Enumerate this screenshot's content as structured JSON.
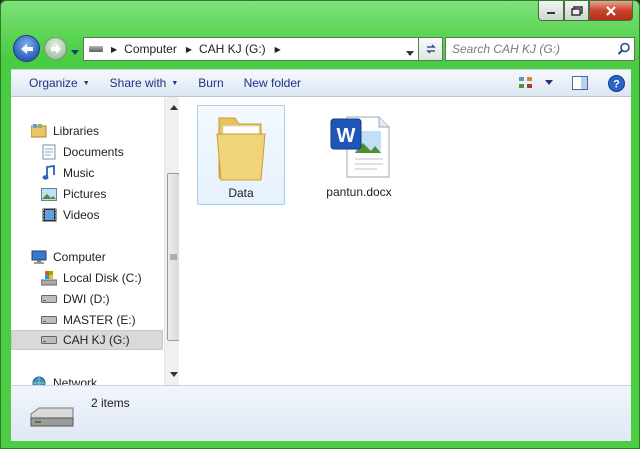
{
  "window": {
    "caption_buttons": [
      "minimize",
      "maximize",
      "close"
    ]
  },
  "address_bar": {
    "icon": "drive-icon",
    "breadcrumbs": [
      "Computer",
      "CAH KJ (G:)"
    ]
  },
  "search": {
    "placeholder": "Search CAH KJ (G:)"
  },
  "toolbar": {
    "items": [
      {
        "label": "Organize",
        "dropdown": true
      },
      {
        "label": "Share with",
        "dropdown": true
      },
      {
        "label": "Burn",
        "dropdown": false
      },
      {
        "label": "New folder",
        "dropdown": false
      }
    ],
    "right_icons": [
      "view-options-icon",
      "preview-pane-icon",
      "help-icon"
    ]
  },
  "nav_pane": {
    "items": [
      {
        "label": "Libraries",
        "icon": "libraries-icon",
        "level": 0
      },
      {
        "label": "Documents",
        "icon": "documents-icon",
        "level": 1
      },
      {
        "label": "Music",
        "icon": "music-icon",
        "level": 1
      },
      {
        "label": "Pictures",
        "icon": "pictures-icon",
        "level": 1
      },
      {
        "label": "Videos",
        "icon": "videos-icon",
        "level": 1
      },
      {
        "label": "Computer",
        "icon": "computer-icon",
        "level": 0
      },
      {
        "label": "Local Disk (C:)",
        "icon": "local-disk-icon",
        "level": 1
      },
      {
        "label": "DWI (D:)",
        "icon": "drive-icon",
        "level": 1
      },
      {
        "label": "MASTER (E:)",
        "icon": "drive-icon",
        "level": 1
      },
      {
        "label": "CAH KJ (G:)",
        "icon": "drive-icon",
        "level": 1,
        "selected": true
      },
      {
        "label": "Network",
        "icon": "network-icon",
        "level": 0
      }
    ]
  },
  "files": [
    {
      "name": "Data",
      "type": "folder",
      "selected": true
    },
    {
      "name": "pantun.docx",
      "type": "word-document",
      "selected": false
    }
  ],
  "status": {
    "count_text": "2 items"
  },
  "colors": {
    "window_frame": "#4ccd44",
    "toolbar_text": "#1e3287",
    "selection": "#e5f1fc"
  }
}
